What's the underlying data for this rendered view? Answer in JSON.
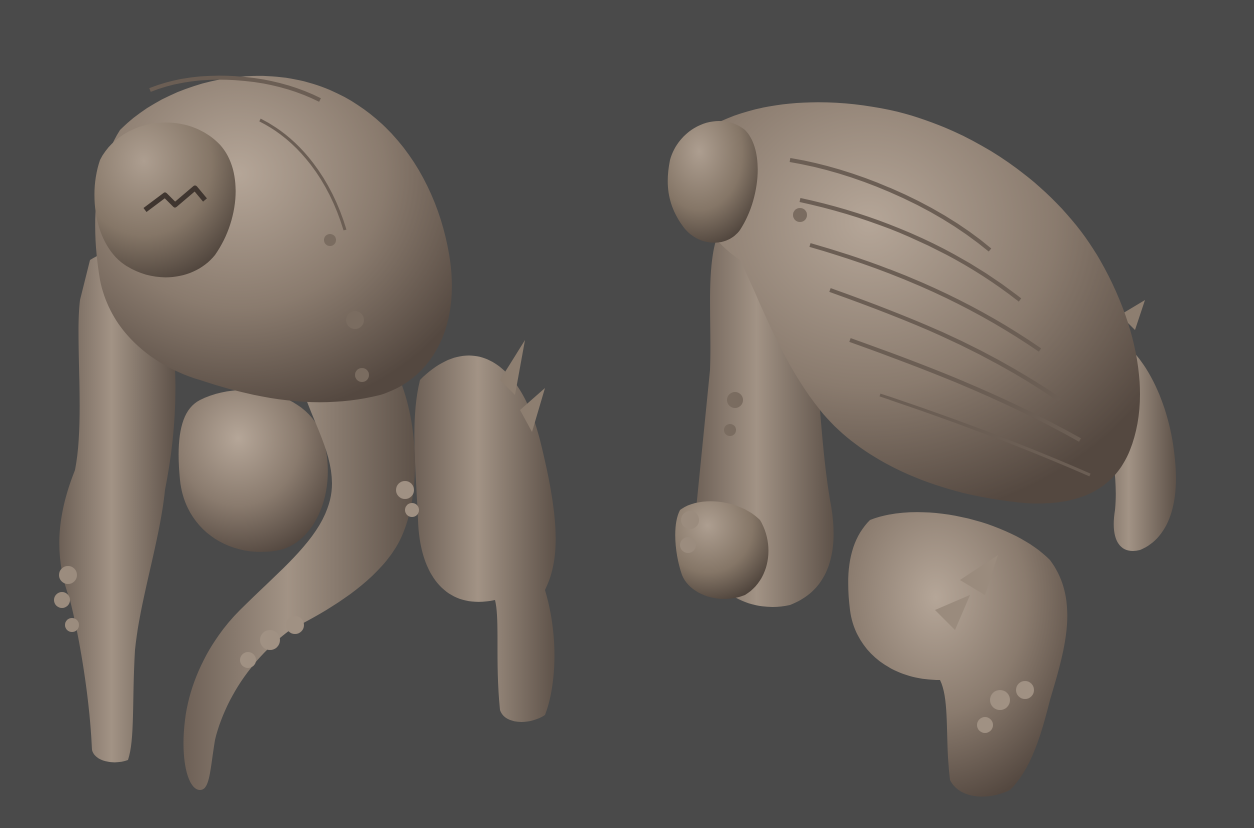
{
  "scene": {
    "background_color": "#4a4a4a",
    "clay_color": "#8a7b6e",
    "clay_highlight": "#b3a496",
    "clay_shadow": "#5a4e45",
    "models": [
      {
        "name": "creature-front-view"
      },
      {
        "name": "creature-back-view"
      }
    ]
  }
}
